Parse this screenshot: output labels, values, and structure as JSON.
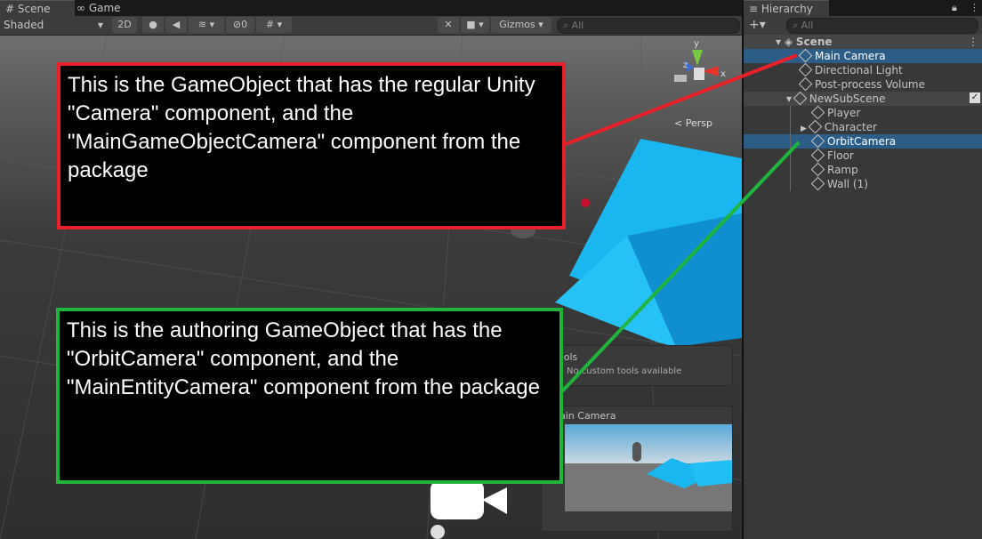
{
  "tabs": {
    "scene": "Scene",
    "game": "Game",
    "hierarchy": "Hierarchy"
  },
  "toolbar": {
    "shading": "Shaded",
    "mode_2d": "2D",
    "hidden_count": "0",
    "gizmos": "Gizmos",
    "search_placeholder": "All"
  },
  "hierarchy": {
    "search_placeholder": "All",
    "items": [
      {
        "label": "Scene"
      },
      {
        "label": "Main Camera"
      },
      {
        "label": "Directional Light"
      },
      {
        "label": "Post-process Volume"
      },
      {
        "label": "NewSubScene"
      },
      {
        "label": "Player"
      },
      {
        "label": "Character"
      },
      {
        "label": "OrbitCamera"
      },
      {
        "label": "Floor"
      },
      {
        "label": "Ramp"
      },
      {
        "label": "Wall (1)"
      }
    ]
  },
  "gizmo": {
    "axis_y": "y",
    "axis_z": "z",
    "axis_x": "x",
    "persp": "< Persp"
  },
  "overlays": {
    "tools_title": "ools",
    "tools_text": "No custom tools available",
    "camera_title": "ain Camera"
  },
  "callouts": {
    "camera": "This is the GameObject that has the regular Unity \"Camera\" component, and the \"MainGameObjectCamera\" component from the package",
    "orbit": "This is the authoring GameObject that has the \"OrbitCamera\" component, and the \"MainEntityCamera\" component from the package"
  },
  "colors": {
    "red": "#e8202a",
    "green": "#1fb43c",
    "selection": "#2c5d87",
    "shape_blue": "#1ab6f0"
  }
}
